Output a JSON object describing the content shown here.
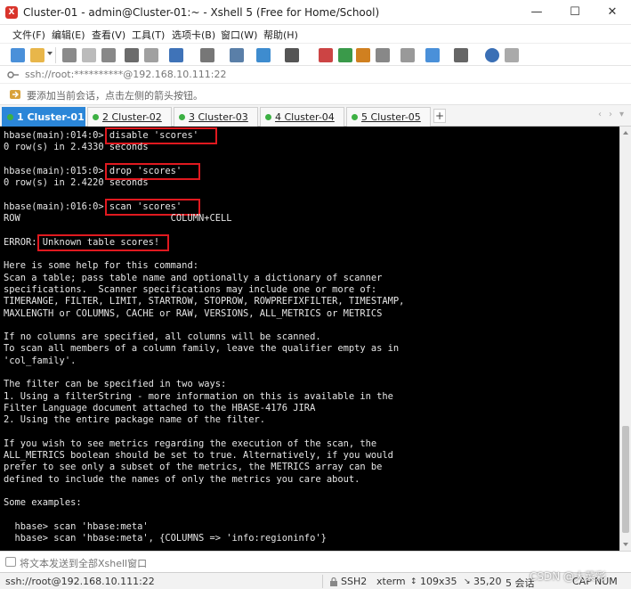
{
  "window": {
    "title": "Cluster-01 - admin@Cluster-01:~ - Xshell 5 (Free for Home/School)",
    "controls": [
      "—",
      "☐",
      "✕"
    ]
  },
  "menu": [
    "文件(F)",
    "编辑(E)",
    "查看(V)",
    "工具(T)",
    "选项卡(B)",
    "窗口(W)",
    "帮助(H)"
  ],
  "address": "ssh://root:**********@192.168.10.111:22",
  "hint": "要添加当前会话，点击左侧的箭头按钮。",
  "tabs": [
    {
      "label": "1 Cluster-01",
      "active": true
    },
    {
      "label": "2 Cluster-02",
      "active": false
    },
    {
      "label": "3 Cluster-03",
      "active": false
    },
    {
      "label": "4 Cluster-04",
      "active": false
    },
    {
      "label": "5 Cluster-05",
      "active": false
    }
  ],
  "tab_add": "+",
  "tab_nav": [
    "‹",
    "›",
    "▾"
  ],
  "terminal": {
    "lines": [
      "hbase(main):014:0> disable 'scores'",
      "0 row(s) in 2.4330 seconds",
      "",
      "hbase(main):015:0> drop 'scores'",
      "0 row(s) in 2.4220 seconds",
      "",
      "hbase(main):016:0> scan 'scores'",
      "ROW                           COLUMN+CELL",
      "",
      "ERROR: Unknown table scores!",
      "",
      "Here is some help for this command:",
      "Scan a table; pass table name and optionally a dictionary of scanner",
      "specifications.  Scanner specifications may include one or more of:",
      "TIMERANGE, FILTER, LIMIT, STARTROW, STOPROW, ROWPREFIXFILTER, TIMESTAMP,",
      "MAXLENGTH or COLUMNS, CACHE or RAW, VERSIONS, ALL_METRICS or METRICS",
      "",
      "If no columns are specified, all columns will be scanned.",
      "To scan all members of a column family, leave the qualifier empty as in",
      "'col_family'.",
      "",
      "The filter can be specified in two ways:",
      "1. Using a filterString - more information on this is available in the",
      "Filter Language document attached to the HBASE-4176 JIRA",
      "2. Using the entire package name of the filter.",
      "",
      "If you wish to see metrics regarding the execution of the scan, the",
      "ALL_METRICS boolean should be set to true. Alternatively, if you would",
      "prefer to see only a subset of the metrics, the METRICS array can be",
      "defined to include the names of only the metrics you care about.",
      "",
      "Some examples:",
      "",
      "  hbase> scan 'hbase:meta'",
      "  hbase> scan 'hbase:meta', {COLUMNS => 'info:regioninfo'}"
    ]
  },
  "compose": "将文本发送到全部Xshell窗口",
  "status": {
    "connection": "ssh://root@192.168.10.111:22",
    "protocol": "SSH2",
    "terminal": "xterm",
    "size": "109x35",
    "cursor": "35,20",
    "sessions": "5 会话",
    "caps": "CAP",
    "num": "NUM"
  },
  "watermark": "CSDN @大菜彩",
  "colors": {
    "active_tab": "#2b86d8",
    "terminal_bg": "#000000",
    "highlight": "#e0191f",
    "status_dot": "#3cb043"
  }
}
